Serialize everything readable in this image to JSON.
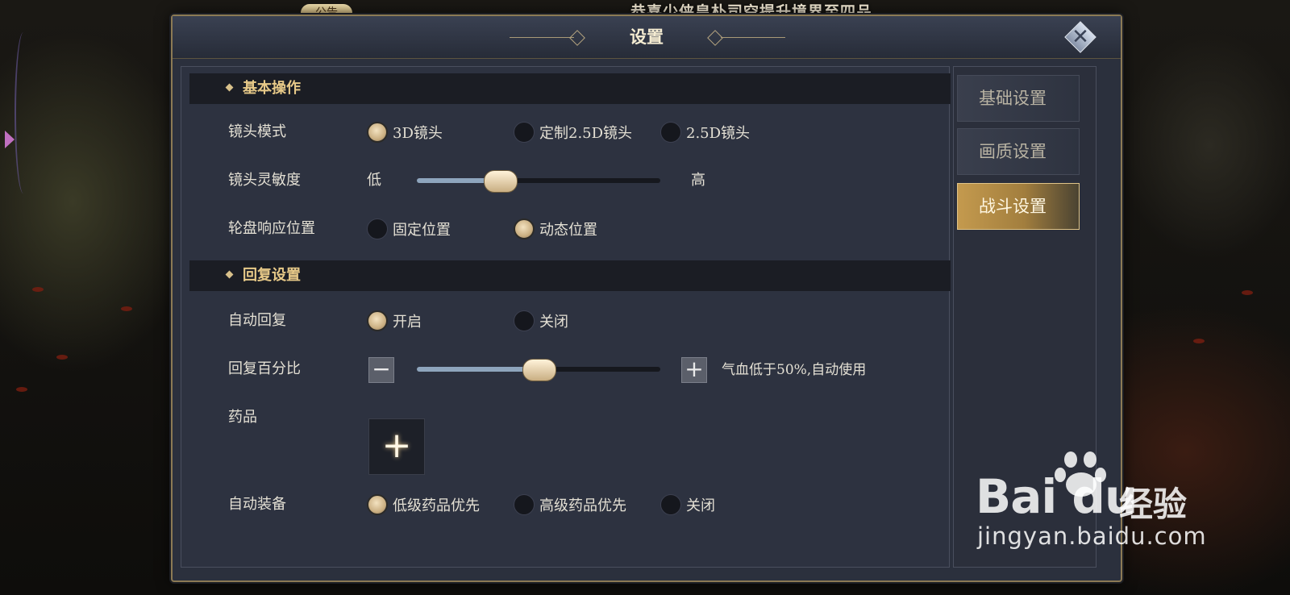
{
  "announcement": {
    "badge": "公告",
    "message": "恭喜少侠皇朴司空提升境界至四品"
  },
  "dialog": {
    "title": "设置",
    "close_icon": "close-icon"
  },
  "sections": {
    "basic": {
      "heading": "基本操作",
      "camera_mode": {
        "label": "镜头模式",
        "options": [
          "3D镜头",
          "定制2.5D镜头",
          "2.5D镜头"
        ],
        "selected": "3D镜头"
      },
      "camera_sensitivity": {
        "label": "镜头灵敏度",
        "low": "低",
        "high": "高",
        "value_fraction": 0.34
      },
      "wheel_position": {
        "label": "轮盘响应位置",
        "options": [
          "固定位置",
          "动态位置"
        ],
        "selected": "动态位置"
      }
    },
    "recovery": {
      "heading": "回复设置",
      "auto_recover": {
        "label": "自动回复",
        "options": [
          "开启",
          "关闭"
        ],
        "selected": "开启"
      },
      "recover_percent": {
        "label": "回复百分比",
        "minus": "−",
        "plus": "+",
        "value_fraction": 0.5,
        "hint": "气血低于50%,自动使用"
      },
      "potion": {
        "label": "药品",
        "add": "+"
      },
      "auto_equip": {
        "label": "自动装备",
        "options": [
          "低级药品优先",
          "高级药品优先",
          "关闭"
        ],
        "selected": "低级药品优先"
      }
    }
  },
  "sidebar": {
    "tabs": [
      {
        "label": "基础设置",
        "active": false
      },
      {
        "label": "画质设置",
        "active": false
      },
      {
        "label": "战斗设置",
        "active": true
      }
    ]
  },
  "watermark": {
    "logo": "Bai du",
    "brand": "经验",
    "url": "jingyan.baidu.com"
  },
  "colors": {
    "accent_gold": "#e7c988",
    "panel_bg": "#2d3240",
    "active_tab": "#c49a4e"
  }
}
